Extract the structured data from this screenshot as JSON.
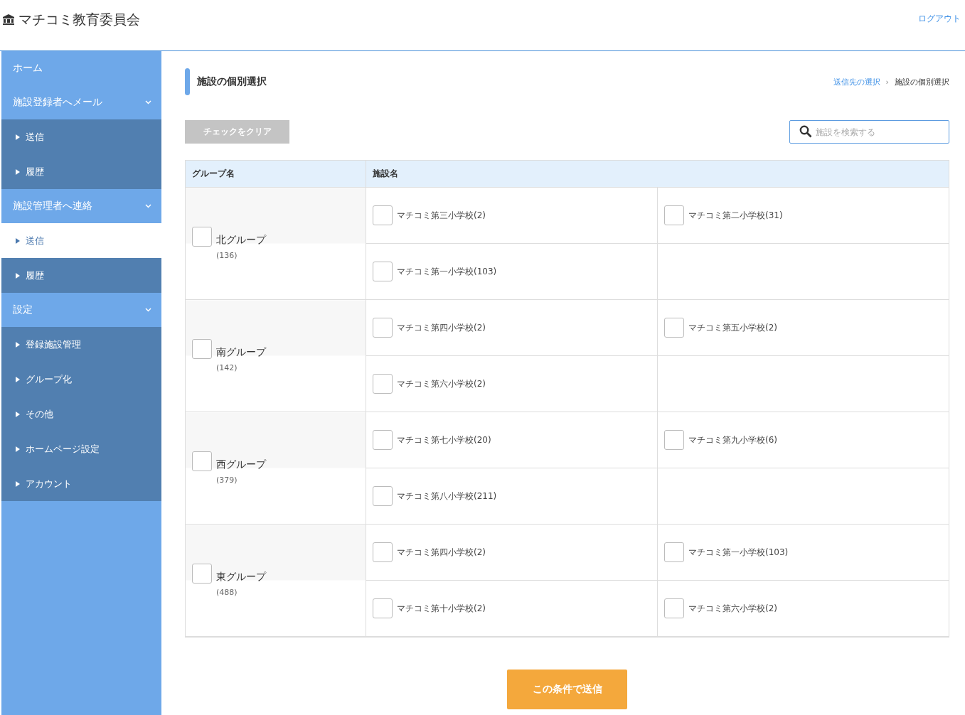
{
  "header": {
    "title": "マチコミ教育委員会",
    "logout": "ログアウト"
  },
  "sidebar": {
    "items": [
      {
        "kind": "top",
        "label": "ホーム",
        "expandable": false,
        "selected": false
      },
      {
        "kind": "top",
        "label": "施設登録者へメール",
        "expandable": true,
        "selected": false
      },
      {
        "kind": "sub",
        "label": "送信",
        "selected": false
      },
      {
        "kind": "sub",
        "label": "履歴",
        "selected": false
      },
      {
        "kind": "top",
        "label": "施設管理者へ連絡",
        "expandable": true,
        "selected": false
      },
      {
        "kind": "sub",
        "label": "送信",
        "selected": true
      },
      {
        "kind": "sub",
        "label": "履歴",
        "selected": false
      },
      {
        "kind": "top",
        "label": "設定",
        "expandable": true,
        "selected": false
      },
      {
        "kind": "sub",
        "label": "登録施設管理",
        "selected": false
      },
      {
        "kind": "sub",
        "label": "グループ化",
        "selected": false
      },
      {
        "kind": "sub",
        "label": "その他",
        "selected": false
      },
      {
        "kind": "sub",
        "label": "ホームページ設定",
        "selected": false
      },
      {
        "kind": "sub",
        "label": "アカウント",
        "selected": false
      }
    ]
  },
  "page": {
    "title": "施設の個別選択",
    "breadcrumb": [
      {
        "label": "送信先の選択",
        "link": true
      },
      {
        "label": "施設の個別選択",
        "link": false
      }
    ],
    "breadcrumb_separator": "›"
  },
  "clear_button": "チェックをクリア",
  "search": {
    "placeholder": "施設を検索する"
  },
  "table": {
    "columns": [
      "グループ名",
      "施設名"
    ],
    "groups": [
      {
        "name": "北グループ",
        "count": "(136)",
        "checked": false,
        "facilities": [
          {
            "name": "マチコミ第三小学校(2)",
            "checked": false
          },
          {
            "name": "マチコミ第二小学校(31)",
            "checked": false
          },
          {
            "name": "マチコミ第一小学校(103)",
            "checked": false
          }
        ]
      },
      {
        "name": "南グループ",
        "count": "(142)",
        "checked": false,
        "facilities": [
          {
            "name": "マチコミ第四小学校(2)",
            "checked": false
          },
          {
            "name": "マチコミ第五小学校(2)",
            "checked": false
          },
          {
            "name": "マチコミ第六小学校(2)",
            "checked": false
          }
        ]
      },
      {
        "name": "西グループ",
        "count": "(379)",
        "checked": false,
        "facilities": [
          {
            "name": "マチコミ第七小学校(20)",
            "checked": false
          },
          {
            "name": "マチコミ第九小学校(6)",
            "checked": false
          },
          {
            "name": "マチコミ第八小学校(211)",
            "checked": false
          }
        ]
      },
      {
        "name": "東グループ",
        "count": "(488)",
        "checked": false,
        "facilities": [
          {
            "name": "マチコミ第四小学校(2)",
            "checked": false
          },
          {
            "name": "マチコミ第一小学校(103)",
            "checked": false
          },
          {
            "name": "マチコミ第十小学校(2)",
            "checked": false
          },
          {
            "name": "マチコミ第六小学校(2)",
            "checked": false
          }
        ]
      }
    ]
  },
  "submit_button": "この条件で送信"
}
